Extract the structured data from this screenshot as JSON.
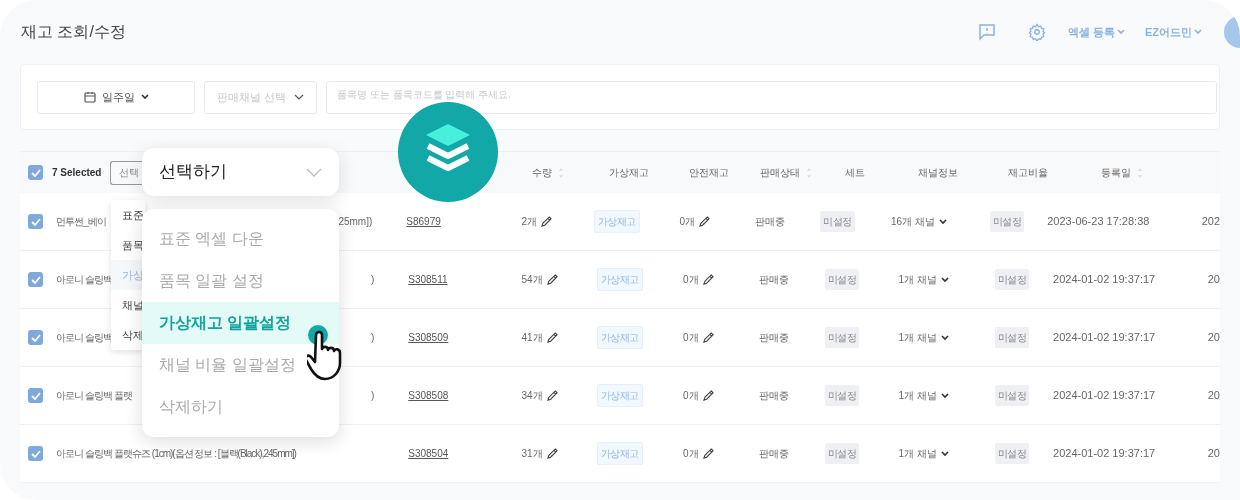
{
  "page_title": "재고 조회/수정",
  "header": {
    "excel_menu": "엑셀 등록",
    "user_menu": "EZ어드민"
  },
  "filters": {
    "period": "일주일",
    "channel_placeholder": "판매채널 선택",
    "search_placeholder": "품목명 또는 품목코드를 입력해 주세요."
  },
  "selection": {
    "checked": true,
    "count_label": "7 Selected",
    "button": "선택"
  },
  "under_menu": [
    {
      "label": "표준",
      "selected": false
    },
    {
      "label": "품목",
      "selected": false
    },
    {
      "label": "가상",
      "selected": true
    },
    {
      "label": "채널",
      "selected": false
    },
    {
      "label": "삭제",
      "selected": false
    }
  ],
  "action_dropdown": {
    "label": "선택하기",
    "expanded": true,
    "items": [
      {
        "label": "표준 엑셀 다운",
        "selected": false
      },
      {
        "label": "품목 일괄 설정",
        "selected": false
      },
      {
        "label": "가상재고 일괄설정",
        "selected": true
      },
      {
        "label": "채널 비율 일괄설정",
        "selected": false
      },
      {
        "label": "삭제하기",
        "selected": false
      }
    ]
  },
  "columns": [
    {
      "label": "수량",
      "sortable": true
    },
    {
      "label": "가상재고",
      "sortable": false
    },
    {
      "label": "안전재고",
      "sortable": false
    },
    {
      "label": "판매상태",
      "sortable": true
    },
    {
      "label": "세트",
      "sortable": false
    },
    {
      "label": "채널정보",
      "sortable": false
    },
    {
      "label": "재고비율",
      "sortable": false
    },
    {
      "label": "등록일",
      "sortable": true
    }
  ],
  "rows": [
    {
      "checked": true,
      "name_start": "먼투썬_베이",
      "name_end": "25mm])",
      "code": "S86979",
      "qty": "2개",
      "virtual": "가상재고",
      "safety": "0개",
      "status": "판매중",
      "set": "미설정",
      "channels": "16개 채널",
      "ratio": "미설정",
      "date": "2023-06-23 17:28:38",
      "column_12": "202"
    },
    {
      "checked": true,
      "name_start": "아로니 슬링백",
      "name_end": ")",
      "code": "S308511",
      "qty": "54개",
      "virtual": "가상재고",
      "safety": "0개",
      "status": "판매중",
      "set": "미설정",
      "channels": "1개 채널",
      "ratio": "미설정",
      "date": "2024-01-02 19:37:17",
      "column_12": "20"
    },
    {
      "checked": true,
      "name_start": "아로니 슬링백",
      "name_end": ")",
      "code": "S308509",
      "qty": "41개",
      "virtual": "가상재고",
      "safety": "0개",
      "status": "판매중",
      "set": "미설정",
      "channels": "1개 채널",
      "ratio": "미설정",
      "date": "2024-01-02 19:37:17",
      "column_12": "20"
    },
    {
      "checked": true,
      "name_start": "아로니 슬링백 플랫",
      "name_end": ")",
      "code": "S308508",
      "qty": "34개",
      "virtual": "가상재고",
      "safety": "0개",
      "status": "판매중",
      "set": "미설정",
      "channels": "1개 채널",
      "ratio": "미설정",
      "date": "2024-01-02 19:37:17",
      "column_12": "20"
    },
    {
      "checked": true,
      "name_start": "아로니 슬링백 플랫슈즈 (1cm)(옵션 정보 : [블랙(Black),245mm])",
      "name_end": "",
      "code": "S308504",
      "qty": "31개",
      "virtual": "가상재고",
      "safety": "0개",
      "status": "판매중",
      "set": "미설정",
      "channels": "1개 채널",
      "ratio": "미설정",
      "date": "2024-01-02 19:37:17",
      "column_12": "20"
    }
  ]
}
